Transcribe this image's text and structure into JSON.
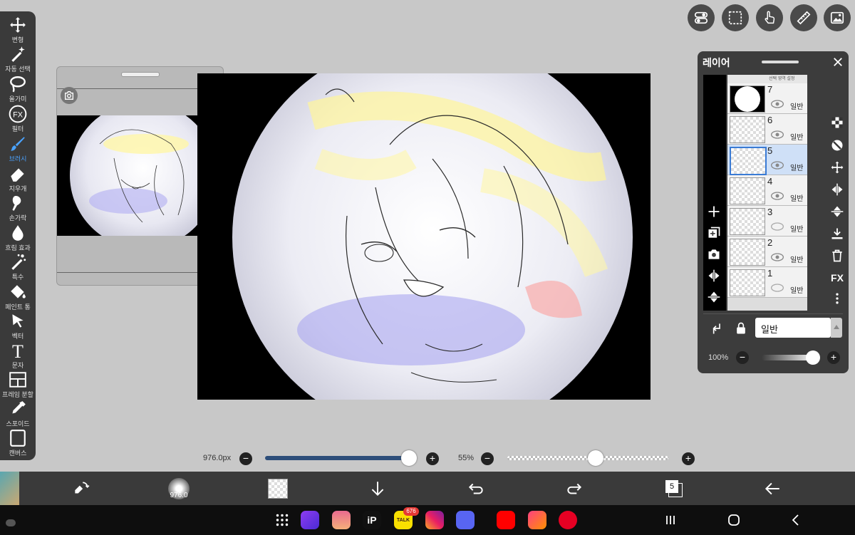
{
  "left_toolbar": {
    "tools": [
      {
        "label": "변형",
        "icon": "move-icon"
      },
      {
        "label": "자동 선택",
        "icon": "magic-wand-icon"
      },
      {
        "label": "올가미",
        "icon": "lasso-icon"
      },
      {
        "label": "필터",
        "icon": "fx-icon",
        "glyph": "FX"
      },
      {
        "label": "브러시",
        "icon": "brush-icon",
        "active": true
      },
      {
        "label": "지우개",
        "icon": "eraser-icon"
      },
      {
        "label": "손가락",
        "icon": "smudge-icon"
      },
      {
        "label": "흐림 효과",
        "icon": "blur-drop-icon"
      },
      {
        "label": "특수",
        "icon": "special-brush-icon"
      },
      {
        "label": "페인트 통",
        "icon": "paint-bucket-icon"
      },
      {
        "label": "벡터",
        "icon": "vector-arrow-icon"
      },
      {
        "label": "문자",
        "icon": "text-icon",
        "glyph": "T"
      },
      {
        "label": "프레임 분할",
        "icon": "frame-divider-icon"
      },
      {
        "label": "스포이드",
        "icon": "eyedropper-icon"
      },
      {
        "label": "캔버스",
        "icon": "canvas-icon"
      }
    ],
    "active_color": "#4aa3ff"
  },
  "layer_panel": {
    "title": "레이어",
    "blend_mode": "일반",
    "opacity": "100%",
    "opacity_value": 1.0,
    "layers": [
      {
        "num": "7",
        "mode": "일반",
        "selected": false
      },
      {
        "num": "6",
        "mode": "일반",
        "selected": false
      },
      {
        "num": "5",
        "mode": "일반",
        "selected": true
      },
      {
        "num": "4",
        "mode": "일반",
        "selected": false
      },
      {
        "num": "3",
        "mode": "일반",
        "selected": false
      },
      {
        "num": "2",
        "mode": "일반",
        "selected": false
      },
      {
        "num": "1",
        "mode": "일반",
        "selected": false
      }
    ],
    "top_row_text": "선택 영역 설정"
  },
  "sliders": {
    "brush_size": "976.0px",
    "brush_size_value": 0.98,
    "opacity": "55%",
    "opacity_value": 0.55
  },
  "bottom_bar": {
    "brush_preview_label": "976.0",
    "layer_count": "5"
  },
  "taskbar": {
    "kakao_badge": "676",
    "kakao_label": "TALK",
    "apps": [
      "grid-icon",
      "internet-icon",
      "gallery-icon",
      "ibis-paint-icon",
      "kakaotalk-icon",
      "instagram-icon",
      "discord-icon",
      "youtube-icon",
      "photos-icon",
      "pinterest-icon"
    ]
  },
  "colors": {
    "toolbar_bg": "#3a3a3a",
    "workspace_bg": "#c8c8c8",
    "selected_layer": "#cfe0f7",
    "accent": "#4aa3ff"
  }
}
